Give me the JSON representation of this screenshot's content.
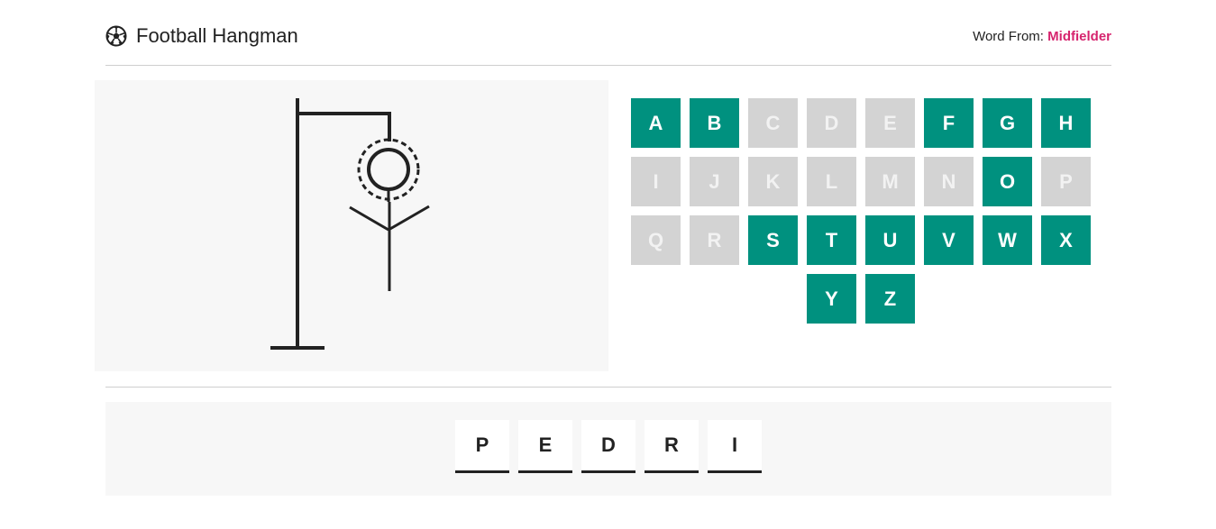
{
  "header": {
    "title": "Football Hangman",
    "icon": "soccer-ball-icon",
    "word_from_label": "Word From:",
    "category": "Midfielder",
    "category_color": "#d6246e"
  },
  "colors": {
    "key_available": "#00917f",
    "key_used": "#d3d3d3"
  },
  "hangman": {
    "parts_drawn": [
      "head",
      "body",
      "left-arm",
      "right-arm"
    ]
  },
  "keyboard": {
    "rows": [
      [
        {
          "letter": "A",
          "state": "available"
        },
        {
          "letter": "B",
          "state": "available"
        },
        {
          "letter": "C",
          "state": "used"
        },
        {
          "letter": "D",
          "state": "used"
        },
        {
          "letter": "E",
          "state": "used"
        },
        {
          "letter": "F",
          "state": "available"
        },
        {
          "letter": "G",
          "state": "available"
        },
        {
          "letter": "H",
          "state": "available"
        }
      ],
      [
        {
          "letter": "I",
          "state": "used"
        },
        {
          "letter": "J",
          "state": "used"
        },
        {
          "letter": "K",
          "state": "used"
        },
        {
          "letter": "L",
          "state": "used"
        },
        {
          "letter": "M",
          "state": "used"
        },
        {
          "letter": "N",
          "state": "used"
        },
        {
          "letter": "O",
          "state": "available"
        },
        {
          "letter": "P",
          "state": "used"
        }
      ],
      [
        {
          "letter": "Q",
          "state": "used"
        },
        {
          "letter": "R",
          "state": "used"
        },
        {
          "letter": "S",
          "state": "available"
        },
        {
          "letter": "T",
          "state": "available"
        },
        {
          "letter": "U",
          "state": "available"
        },
        {
          "letter": "V",
          "state": "available"
        },
        {
          "letter": "W",
          "state": "available"
        },
        {
          "letter": "X",
          "state": "available"
        }
      ],
      [
        {
          "letter": "Y",
          "state": "available"
        },
        {
          "letter": "Z",
          "state": "available"
        }
      ]
    ]
  },
  "word": {
    "letters": [
      "P",
      "E",
      "D",
      "R",
      "I"
    ]
  }
}
